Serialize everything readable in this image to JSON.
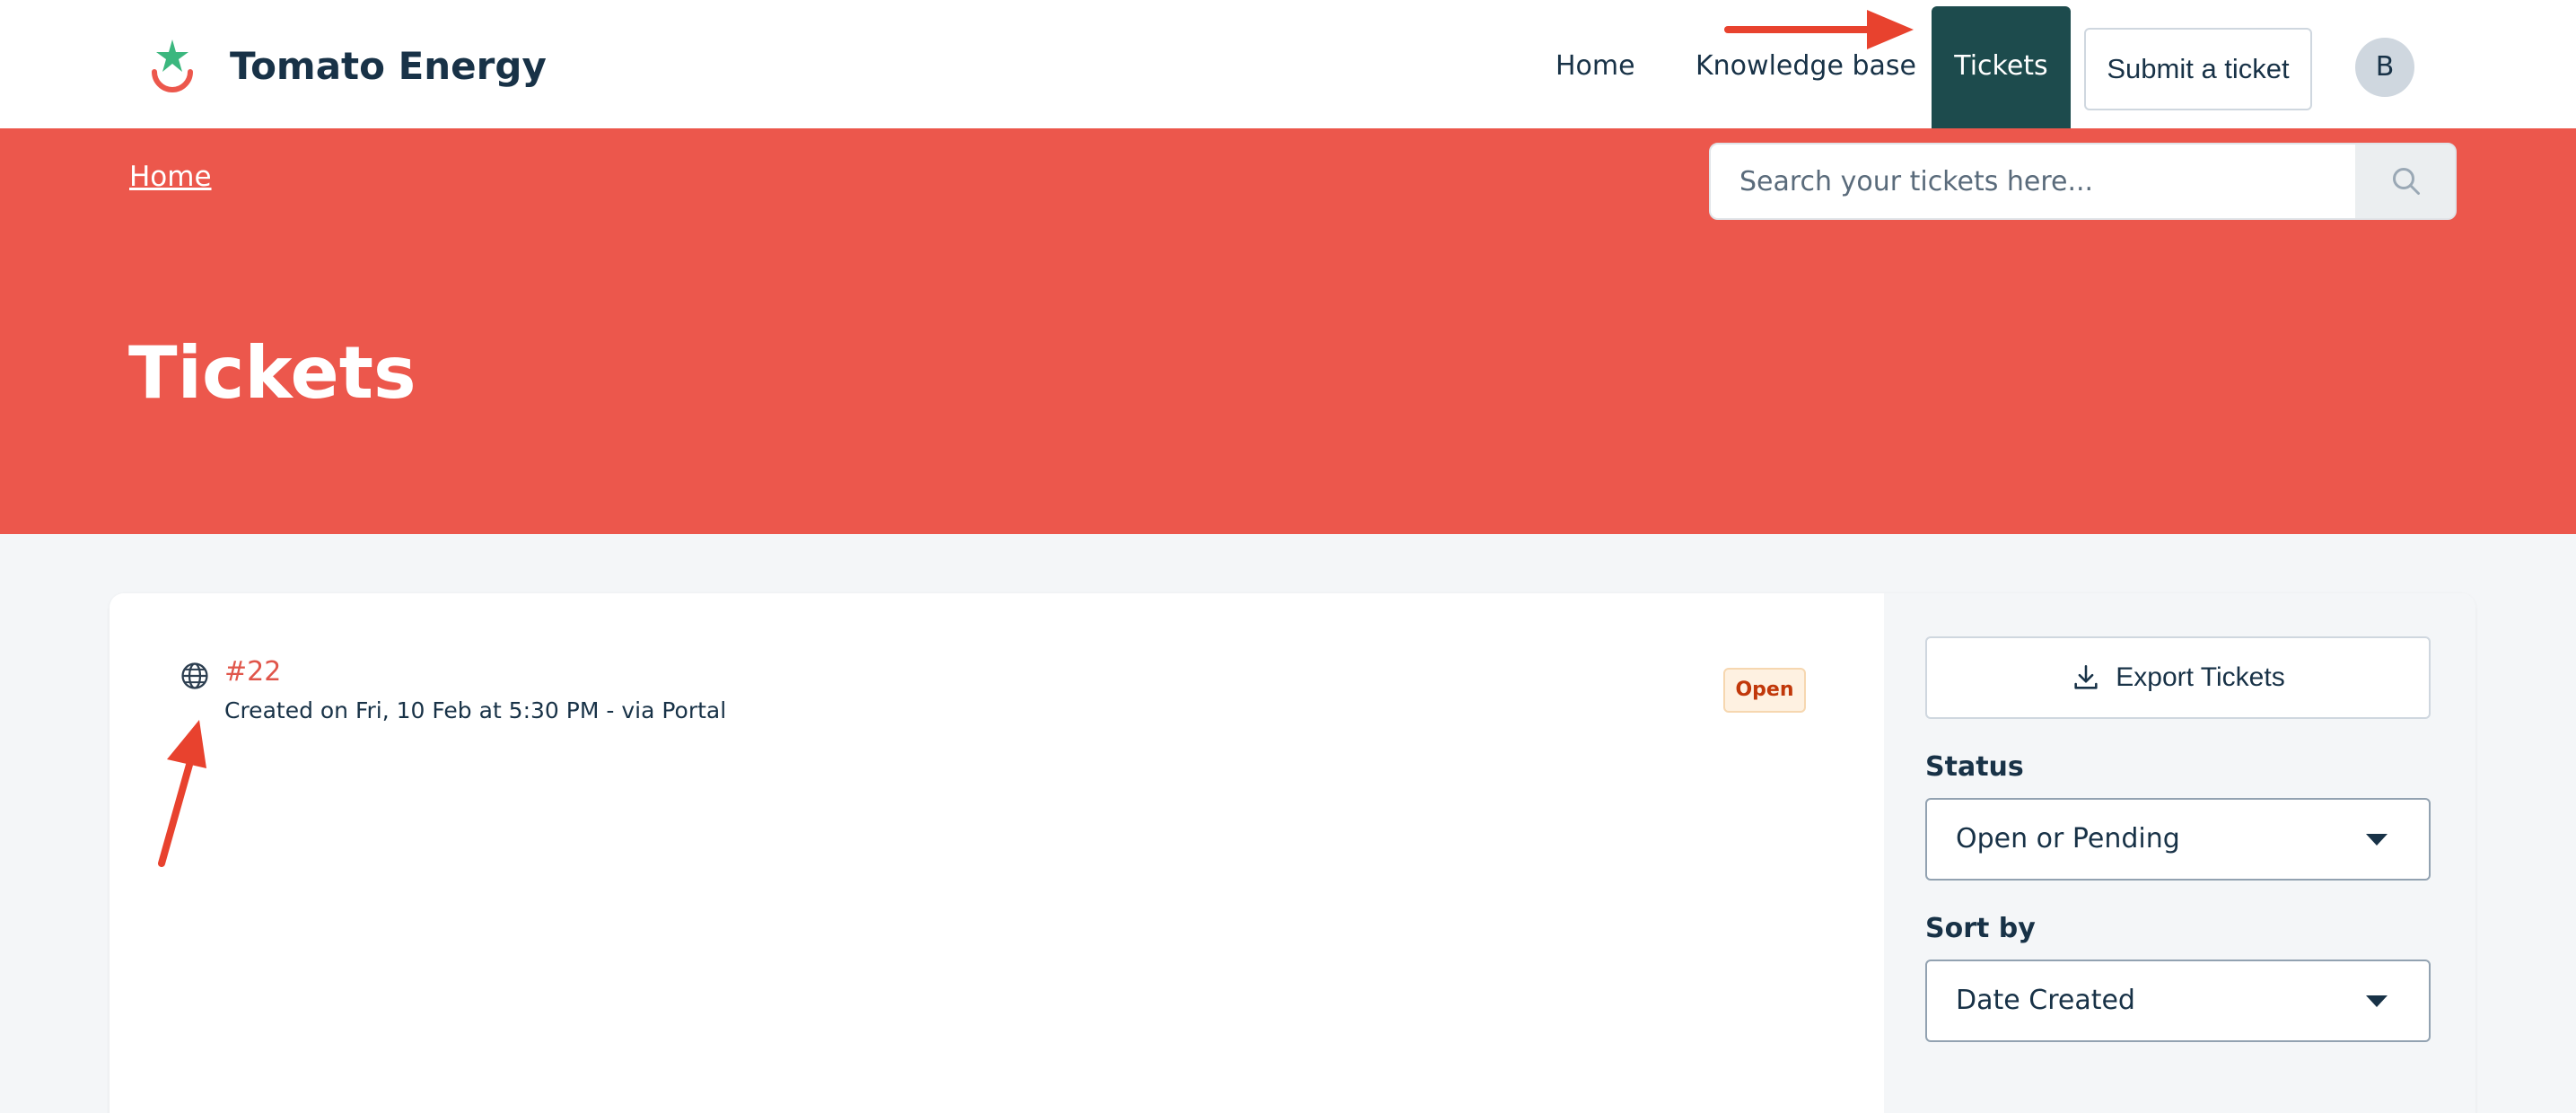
{
  "brand": {
    "name": "Tomato Energy"
  },
  "nav": {
    "home": "Home",
    "knowledge_base": "Knowledge base",
    "tickets": "Tickets",
    "submit_ticket": "Submit a ticket",
    "avatar_initial": "B"
  },
  "hero": {
    "breadcrumb": "Home",
    "search_placeholder": "Search your tickets here...",
    "title": "Tickets"
  },
  "tickets": [
    {
      "id": "#22",
      "meta": "Created on Fri, 10 Feb at 5:30 PM - via Portal",
      "status": "Open",
      "source_icon": "globe-icon"
    }
  ],
  "sidebar": {
    "export_label": "Export Tickets",
    "status_label": "Status",
    "status_value": "Open or Pending",
    "sort_label": "Sort by",
    "sort_value": "Date Created"
  },
  "colors": {
    "hero_bg": "#ec574c",
    "active_tab": "#1d4b4d",
    "annotation_arrow": "#e8422e"
  }
}
